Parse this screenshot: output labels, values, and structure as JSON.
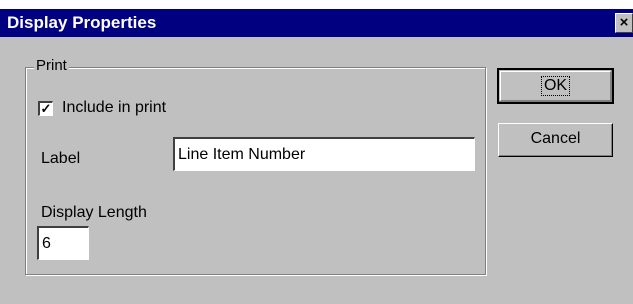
{
  "window": {
    "title": "Display Properties",
    "close_glyph": "×"
  },
  "group": {
    "label": "Print"
  },
  "include_in_print": {
    "label": "Include in print",
    "checked": true,
    "check_glyph": "✓"
  },
  "label_field": {
    "label": "Label",
    "value": "Line Item Number"
  },
  "display_length": {
    "label": "Display Length",
    "value": "6"
  },
  "buttons": {
    "ok": "OK",
    "cancel": "Cancel"
  },
  "colors": {
    "titlebar": "#000080",
    "face": "#c0c0c0"
  }
}
